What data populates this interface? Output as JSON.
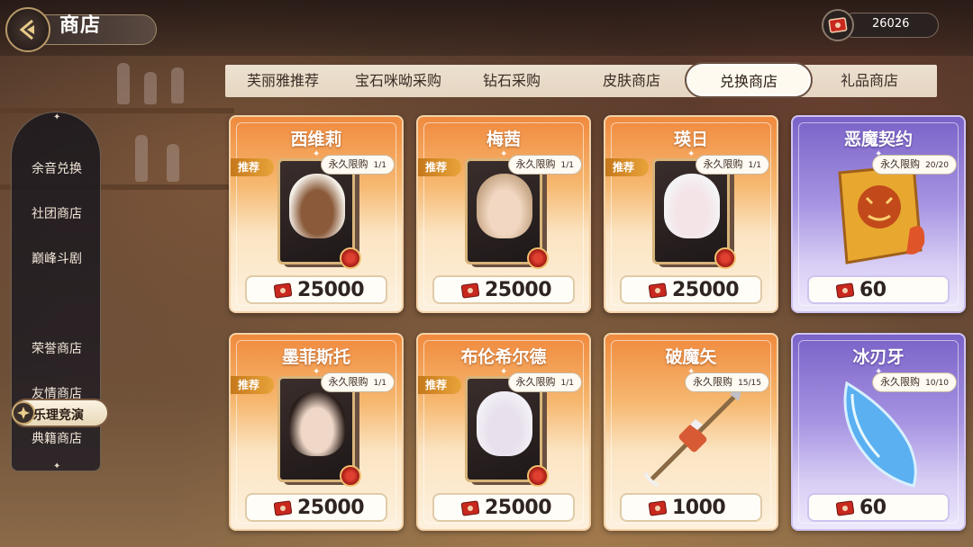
{
  "header": {
    "title": "商店",
    "currency": {
      "icon": "red-gem-book-icon",
      "value": "26026"
    }
  },
  "tabs": [
    {
      "label": "芙丽雅推荐",
      "active": false
    },
    {
      "label": "宝石咪呦采购",
      "active": false
    },
    {
      "label": "钻石采购",
      "active": false
    },
    {
      "label": "皮肤商店",
      "active": false
    },
    {
      "label": "兑换商店",
      "active": true
    },
    {
      "label": "礼品商店",
      "active": false
    }
  ],
  "sidebar": {
    "items": [
      {
        "label": "余音兑换"
      },
      {
        "label": "社团商店"
      },
      {
        "label": "巅峰斗剧"
      },
      {
        "label": "乐理竞演",
        "active": true
      },
      {
        "label": "荣誉商店"
      },
      {
        "label": "友情商店"
      },
      {
        "label": "典籍商店"
      }
    ]
  },
  "colors": {
    "orange_card": "#f08a3e",
    "purple_card": "#7a62c8",
    "badge": "#d88a28"
  },
  "shop": {
    "cards": [
      {
        "name": "西维莉",
        "recommended": "推荐",
        "limit_label": "永久限购",
        "limit_count": "1/1",
        "price": "25000",
        "kind": "character",
        "theme": "orange"
      },
      {
        "name": "梅茜",
        "recommended": "推荐",
        "limit_label": "永久限购",
        "limit_count": "1/1",
        "price": "25000",
        "kind": "character",
        "theme": "orange"
      },
      {
        "name": "瑛日",
        "recommended": "推荐",
        "limit_label": "永久限购",
        "limit_count": "1/1",
        "price": "25000",
        "kind": "character",
        "theme": "orange"
      },
      {
        "name": "恶魔契约",
        "recommended": "",
        "limit_label": "永久限购",
        "limit_count": "20/20",
        "price": "60",
        "kind": "item",
        "icon": "demon-contract-icon",
        "theme": "purple"
      },
      {
        "name": "墨菲斯托",
        "recommended": "推荐",
        "limit_label": "永久限购",
        "limit_count": "1/1",
        "price": "25000",
        "kind": "character",
        "theme": "orange"
      },
      {
        "name": "布伦希尔德",
        "recommended": "推荐",
        "limit_label": "永久限购",
        "limit_count": "1/1",
        "price": "25000",
        "kind": "character",
        "theme": "orange"
      },
      {
        "name": "破魔矢",
        "recommended": "",
        "limit_label": "永久限购",
        "limit_count": "15/15",
        "price": "1000",
        "kind": "item",
        "icon": "demon-breaking-arrow-icon",
        "theme": "orange"
      },
      {
        "name": "冰刃牙",
        "recommended": "",
        "limit_label": "永久限购",
        "limit_count": "10/10",
        "price": "60",
        "kind": "item",
        "icon": "ice-fang-icon",
        "theme": "purple"
      }
    ]
  }
}
